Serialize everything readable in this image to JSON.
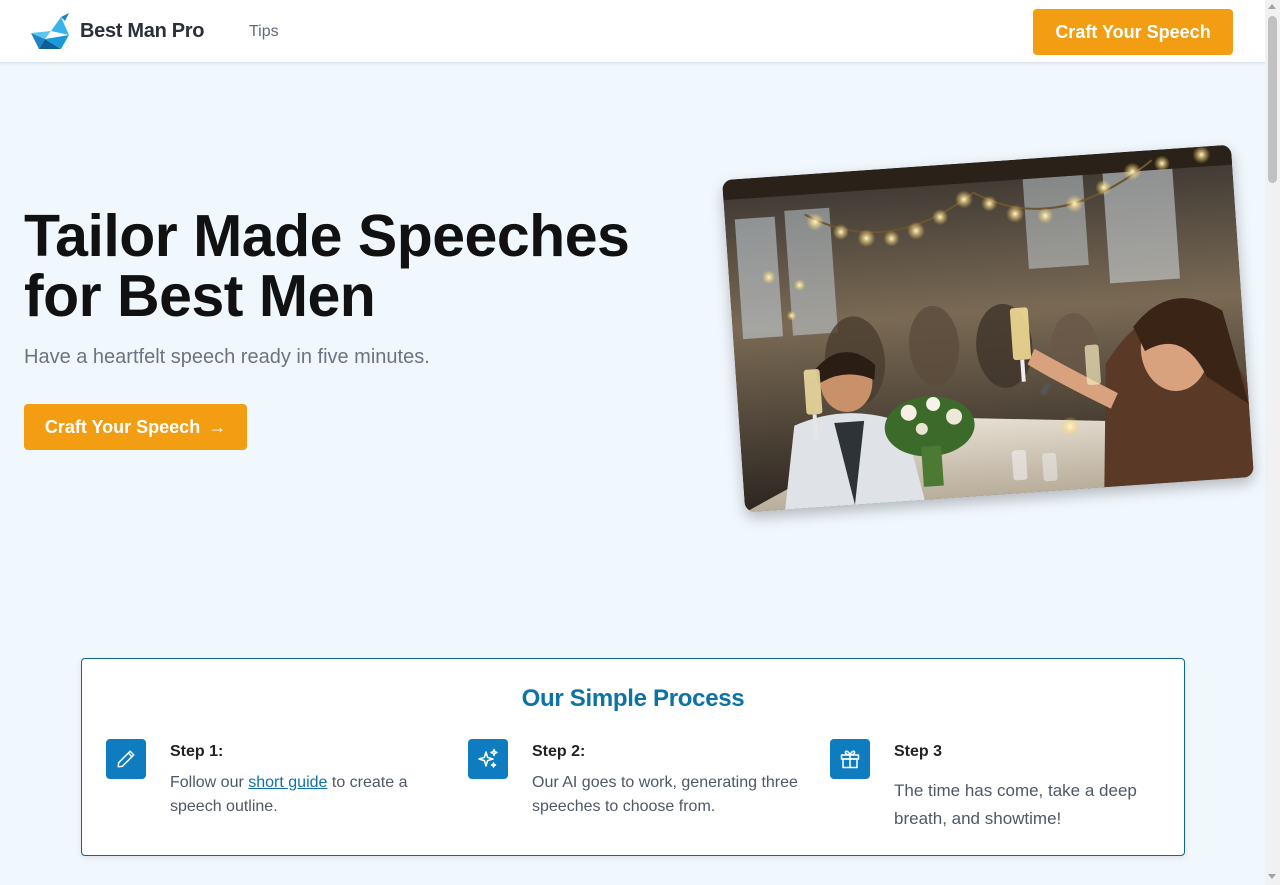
{
  "header": {
    "brand": "Best Man Pro",
    "nav_tips": "Tips",
    "cta": "Craft Your Speech"
  },
  "hero": {
    "title": "Tailor Made Speeches for Best Men",
    "subtitle": "Have a heartfelt speech ready in five minutes.",
    "cta": "Craft Your Speech",
    "cta_arrow": "→"
  },
  "process": {
    "title": "Our Simple Process",
    "steps": [
      {
        "title": "Step 1:",
        "text_before": "Follow our ",
        "link": "short guide",
        "text_after": " to create a speech outline.",
        "icon": "pencil-icon"
      },
      {
        "title": "Step 2:",
        "text": "Our AI goes to work, generating three speeches to choose from.",
        "icon": "sparkles-icon"
      },
      {
        "title": "Step 3",
        "text": "The time has come, take a deep breath, and showtime!",
        "icon": "gift-icon"
      }
    ]
  },
  "colors": {
    "accent": "#f29d12",
    "primary_blue": "#0f7cc0",
    "background": "#f0f7fd"
  }
}
